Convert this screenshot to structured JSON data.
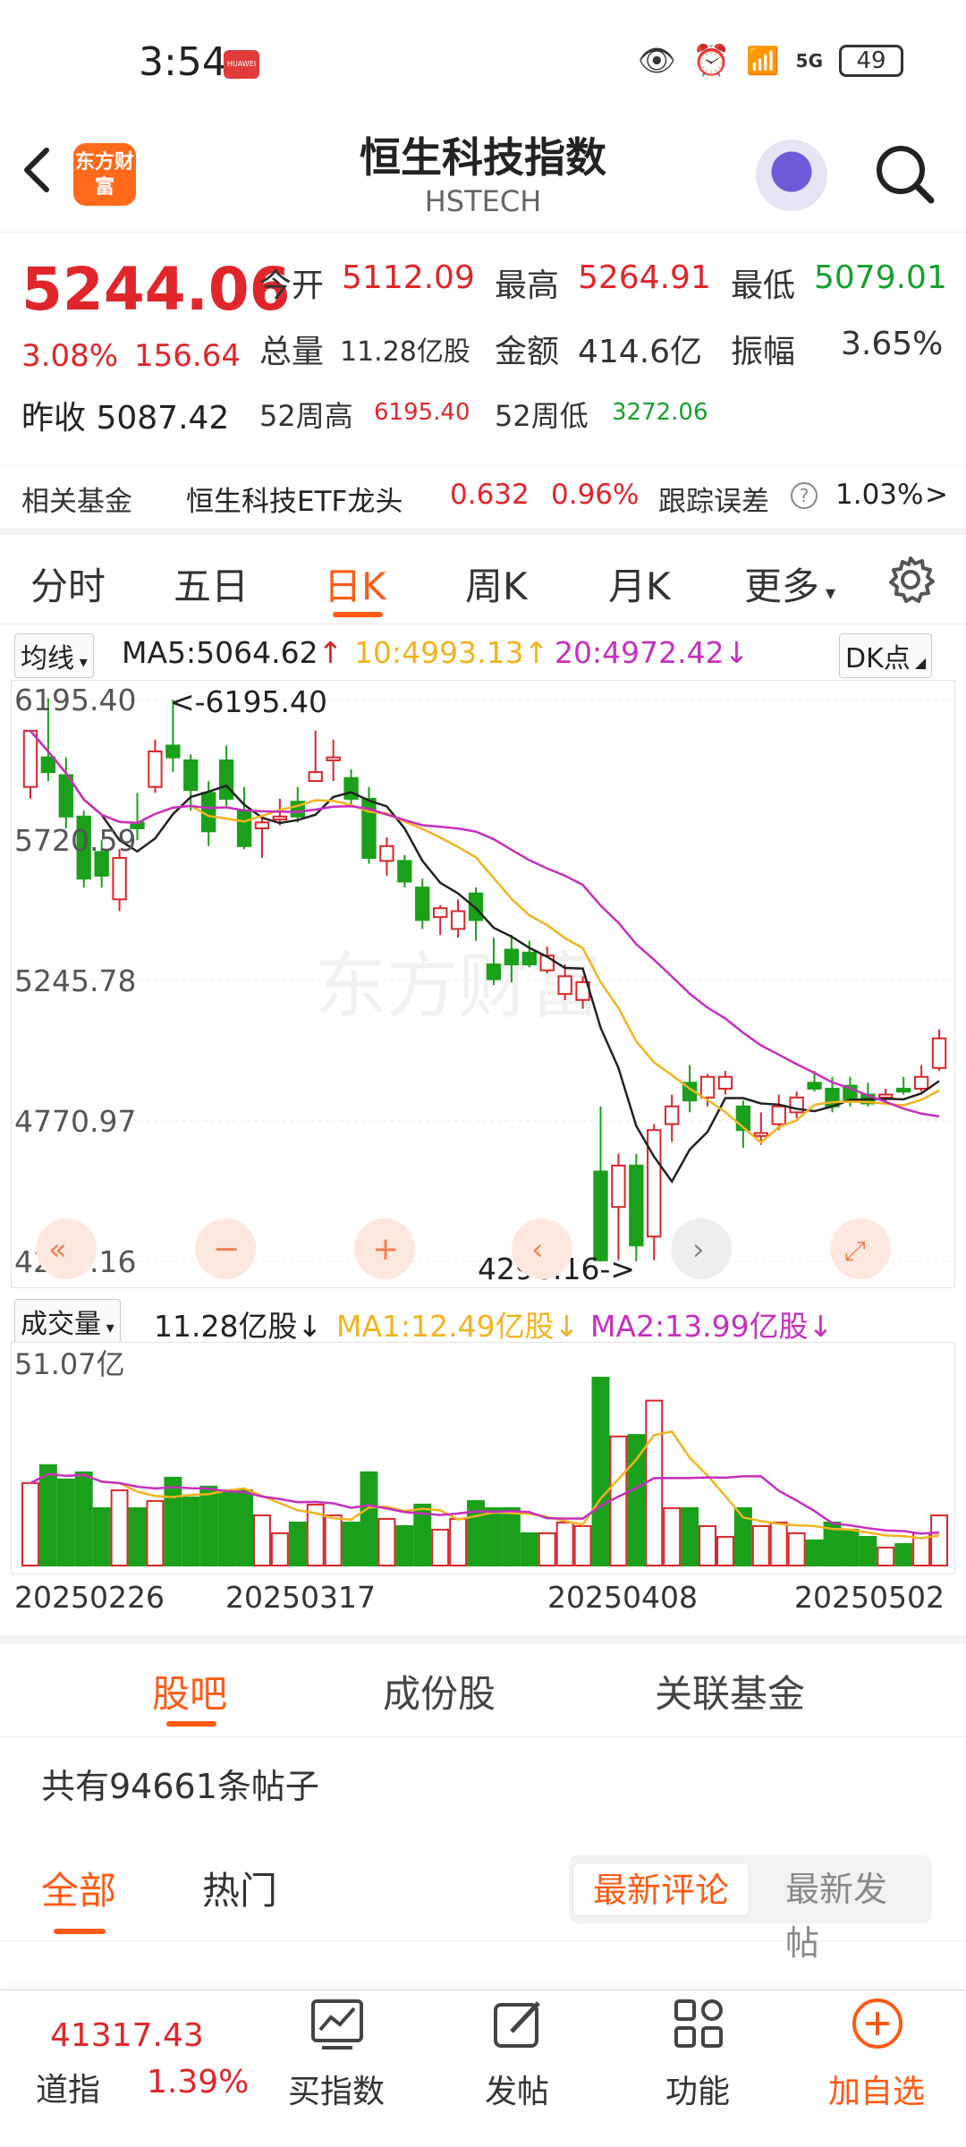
{
  "status": {
    "time": "3:54",
    "huawei_badge": "HUAWEI",
    "battery": "49",
    "network": "5G"
  },
  "header": {
    "title": "恒生科技指数",
    "subtitle": "HSTECH",
    "logo_text": "东方财富"
  },
  "quote": {
    "price": "5244.06",
    "change_pct": "3.08%",
    "change_abs": "156.64",
    "prev_close_label": "昨收",
    "prev_close": "5087.42",
    "open_label": "今开",
    "open": "5112.09",
    "high_label": "最高",
    "high": "5264.91",
    "low_label": "最低",
    "low": "5079.01",
    "volume_label": "总量",
    "volume": "11.28亿股",
    "amount_label": "金额",
    "amount": "414.6亿",
    "amplitude_label": "振幅",
    "amplitude": "3.65%",
    "high52_label": "52周高",
    "high52": "6195.40",
    "low52_label": "52周低",
    "low52": "3272.06"
  },
  "fund": {
    "label": "相关基金",
    "name": "恒生科技ETF龙头",
    "price": "0.632",
    "pct": "0.96%",
    "tracking_label": "跟踪误差",
    "tracking": "1.03%",
    "arrow": ">"
  },
  "tabs": [
    "分时",
    "五日",
    "日K",
    "周K",
    "月K",
    "更多"
  ],
  "indicators": {
    "selector": "均线",
    "ma5": "MA5:5064.62",
    "ma10": "10:4993.13",
    "ma20": "20:4972.42",
    "dk_button": "DK点"
  },
  "chart_data": {
    "type": "candlestick",
    "y_ticks": [
      "6195.40",
      "5720.59",
      "5245.78",
      "4770.97",
      "4296.16"
    ],
    "ylim": [
      4296.16,
      6195.4
    ],
    "max_annotation": "<-6195.40",
    "min_annotation": "4296.16->",
    "x_labels": [
      "20250226",
      "20250317",
      "20250408",
      "20250502"
    ],
    "candles": [
      [
        5900,
        6090,
        6090,
        5860
      ],
      [
        6000,
        5950,
        6200,
        5920
      ],
      [
        5940,
        5800,
        6000,
        5760
      ],
      [
        5800,
        5590,
        5820,
        5560
      ],
      [
        5680,
        5600,
        5720,
        5560
      ],
      [
        5520,
        5660,
        5690,
        5480
      ],
      [
        5780,
        5760,
        5880,
        5720
      ],
      [
        5900,
        6020,
        6060,
        5880
      ],
      [
        6040,
        6000,
        6195,
        5950
      ],
      [
        5990,
        5890,
        6010,
        5820
      ],
      [
        5880,
        5750,
        5920,
        5700
      ],
      [
        5990,
        5860,
        6040,
        5830
      ],
      [
        5820,
        5700,
        5900,
        5690
      ],
      [
        5760,
        5780,
        5800,
        5660
      ],
      [
        5790,
        5800,
        5860,
        5770
      ],
      [
        5850,
        5800,
        5900,
        5780
      ],
      [
        5920,
        5950,
        6090,
        5920
      ],
      [
        5990,
        6000,
        6060,
        5920
      ],
      [
        5930,
        5860,
        5960,
        5840
      ],
      [
        5860,
        5660,
        5900,
        5640
      ],
      [
        5650,
        5700,
        5730,
        5600
      ],
      [
        5650,
        5580,
        5670,
        5560
      ],
      [
        5560,
        5450,
        5590,
        5420
      ],
      [
        5460,
        5490,
        5500,
        5400
      ],
      [
        5420,
        5480,
        5520,
        5390
      ],
      [
        5540,
        5450,
        5560,
        5380
      ],
      [
        5300,
        5250,
        5390,
        5230
      ],
      [
        5350,
        5300,
        5400,
        5240
      ],
      [
        5340,
        5300,
        5380,
        5290
      ],
      [
        5280,
        5330,
        5360,
        5270
      ],
      [
        5200,
        5260,
        5300,
        5180
      ],
      [
        5180,
        5240,
        5260,
        5150
      ],
      [
        4600,
        4300,
        4820,
        4296
      ],
      [
        4480,
        4620,
        4660,
        4300
      ],
      [
        4620,
        4350,
        4660,
        4296
      ],
      [
        4380,
        4740,
        4760,
        4300
      ],
      [
        4760,
        4820,
        4860,
        4700
      ],
      [
        4900,
        4840,
        4960,
        4800
      ],
      [
        4850,
        4920,
        4930,
        4820
      ],
      [
        4880,
        4920,
        4940,
        4860
      ],
      [
        4820,
        4740,
        4840,
        4680
      ],
      [
        4720,
        4730,
        4800,
        4690
      ],
      [
        4760,
        4820,
        4860,
        4740
      ],
      [
        4800,
        4850,
        4870,
        4780
      ],
      [
        4900,
        4880,
        4940,
        4870
      ],
      [
        4880,
        4820,
        4920,
        4800
      ],
      [
        4890,
        4840,
        4920,
        4820
      ],
      [
        4860,
        4830,
        4900,
        4820
      ],
      [
        4850,
        4860,
        4880,
        4830
      ],
      [
        4880,
        4870,
        4920,
        4860
      ],
      [
        4880,
        4920,
        4960,
        4870
      ],
      [
        4950,
        5050,
        5080,
        4940
      ]
    ],
    "series_colors": {
      "up": "#d8262a",
      "down": "#1aa01a",
      "ma5": "#222222",
      "ma10": "#f2b320",
      "ma20": "#c62fbe"
    }
  },
  "volume": {
    "selector": "成交量",
    "value": "11.28亿股",
    "ma1": "MA1:12.49亿股",
    "ma2": "MA2:13.99亿股",
    "max_label": "51.07亿"
  },
  "bottom_tabs": [
    "股吧",
    "成份股",
    "关联基金"
  ],
  "post_count": "共有94661条帖子",
  "filters": {
    "all": "全部",
    "hot": "热门",
    "latest_comment": "最新评论",
    "latest_post": "最新发帖"
  },
  "bottom_nav": {
    "dj_value": "41317.43",
    "dj_name": "道指",
    "dj_change": "1.39%",
    "buy": "买指数",
    "post": "发帖",
    "func": "功能",
    "add": "加自选"
  }
}
